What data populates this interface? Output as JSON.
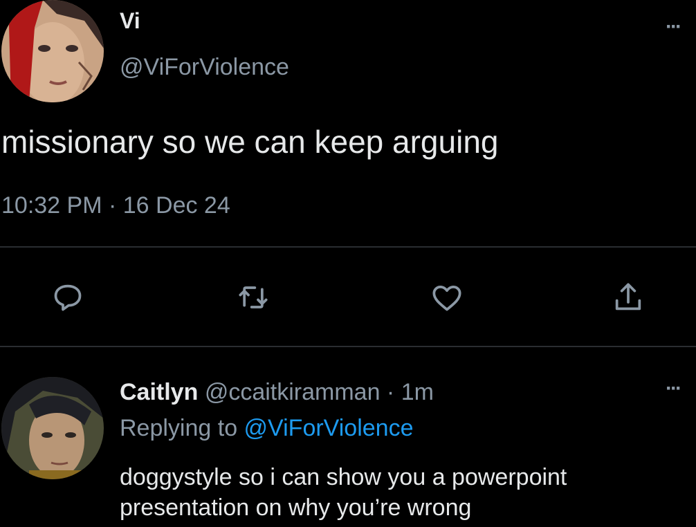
{
  "colors": {
    "background": "#000000",
    "text": "#e7e9ea",
    "secondary": "#8b98a5",
    "link": "#1d9bf0",
    "divider": "#2a2d31"
  },
  "tweet": {
    "author_name": "Vi",
    "author_handle": "@ViForViolence",
    "text": "missionary so we can keep arguing",
    "timestamp": "10:32 PM · 16 Dec 24",
    "more_label": "···"
  },
  "actions": [
    {
      "name": "reply",
      "icon": "speech-bubble-icon"
    },
    {
      "name": "retweet",
      "icon": "retweet-arrows-icon"
    },
    {
      "name": "like",
      "icon": "heart-icon"
    },
    {
      "name": "share",
      "icon": "share-upload-icon"
    }
  ],
  "reply": {
    "author_name": "Caitlyn",
    "author_handle": "@ccaitkiramman",
    "separator": " · ",
    "time_ago": "1m",
    "replying_prefix": "Replying to ",
    "replying_to": "@ViForViolence",
    "text": "doggystyle so i can show you a powerpoint presentation on why you’re wrong",
    "more_label": "···"
  }
}
